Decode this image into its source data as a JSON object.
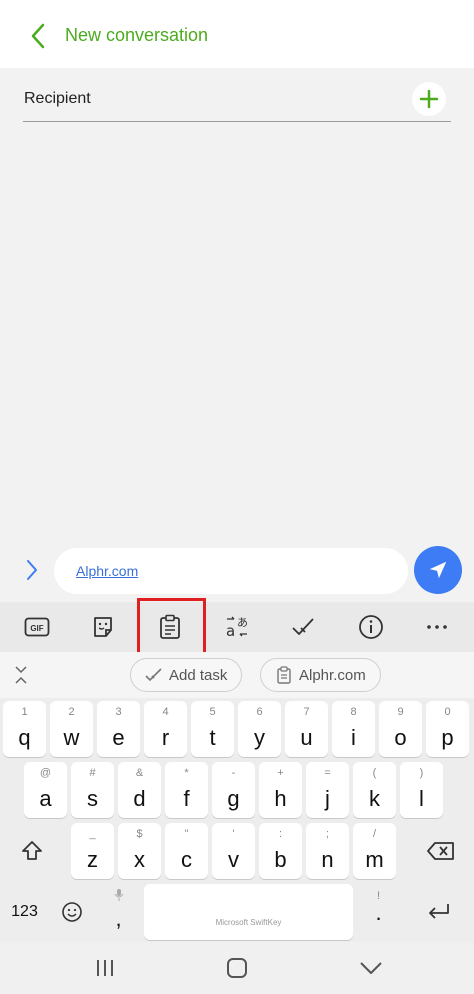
{
  "header": {
    "title": "New conversation",
    "back_icon": "chevron-left-icon"
  },
  "recipient": {
    "label": "Recipient",
    "add_icon": "plus-icon"
  },
  "compose": {
    "message_text": "Alphr.com",
    "expand_icon": "chevron-right-icon",
    "send_icon": "send-icon"
  },
  "toolbar": {
    "gif_label": "GIF",
    "items": [
      "gif-icon",
      "sticker-icon",
      "clipboard-icon",
      "translate-icon",
      "check-icon",
      "info-icon",
      "more-icon"
    ]
  },
  "suggestions": {
    "chips": [
      "Add task",
      "Alphr.com"
    ]
  },
  "keyboard": {
    "row1": [
      {
        "main": "q",
        "sub": "1"
      },
      {
        "main": "w",
        "sub": "2"
      },
      {
        "main": "e",
        "sub": "3"
      },
      {
        "main": "r",
        "sub": "4"
      },
      {
        "main": "t",
        "sub": "5"
      },
      {
        "main": "y",
        "sub": "6"
      },
      {
        "main": "u",
        "sub": "7"
      },
      {
        "main": "i",
        "sub": "8"
      },
      {
        "main": "o",
        "sub": "9"
      },
      {
        "main": "p",
        "sub": "0"
      }
    ],
    "row2": [
      {
        "main": "a",
        "sub": "@"
      },
      {
        "main": "s",
        "sub": "#"
      },
      {
        "main": "d",
        "sub": "&"
      },
      {
        "main": "f",
        "sub": "*"
      },
      {
        "main": "g",
        "sub": "-"
      },
      {
        "main": "h",
        "sub": "+"
      },
      {
        "main": "j",
        "sub": "="
      },
      {
        "main": "k",
        "sub": "("
      },
      {
        "main": "l",
        "sub": ")"
      }
    ],
    "row3": [
      {
        "main": "z",
        "sub": "_"
      },
      {
        "main": "x",
        "sub": "$"
      },
      {
        "main": "c",
        "sub": "\""
      },
      {
        "main": "v",
        "sub": "'"
      },
      {
        "main": "b",
        "sub": ":"
      },
      {
        "main": "n",
        "sub": ";"
      },
      {
        "main": "m",
        "sub": "/"
      }
    ],
    "row4": {
      "numbers": "123",
      "comma": ",",
      "space": "Microsoft SwiftKey",
      "period": ".",
      "period_sub": "!"
    }
  },
  "navbar": {
    "items": [
      "recent-apps-icon",
      "home-icon",
      "back-icon"
    ]
  }
}
